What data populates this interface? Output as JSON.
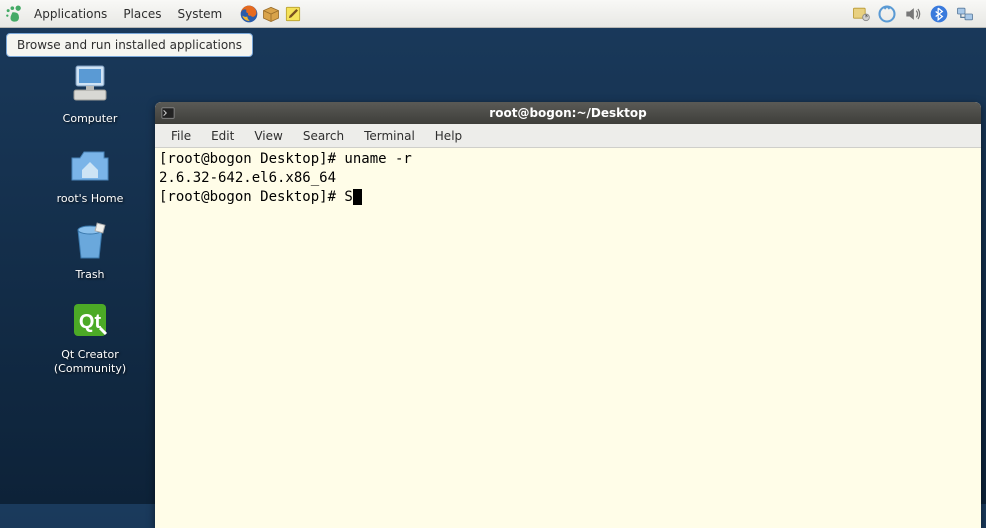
{
  "panel": {
    "menus": {
      "applications": "Applications",
      "places": "Places",
      "system": "System"
    },
    "tooltip": "Browse and run installed applications"
  },
  "desktop": {
    "icons": {
      "computer": "Computer",
      "home": "root's Home",
      "trash": "Trash",
      "qtcreator_line1": "Qt Creator",
      "qtcreator_line2": "(Community)"
    }
  },
  "terminal": {
    "title": "root@bogon:~/Desktop",
    "menus": {
      "file": "File",
      "edit": "Edit",
      "view": "View",
      "search": "Search",
      "terminal": "Terminal",
      "help": "Help"
    },
    "lines": {
      "l1": "[root@bogon Desktop]# uname -r",
      "l2": "2.6.32-642.el6.x86_64",
      "l3": "[root@bogon Desktop]# S"
    }
  }
}
